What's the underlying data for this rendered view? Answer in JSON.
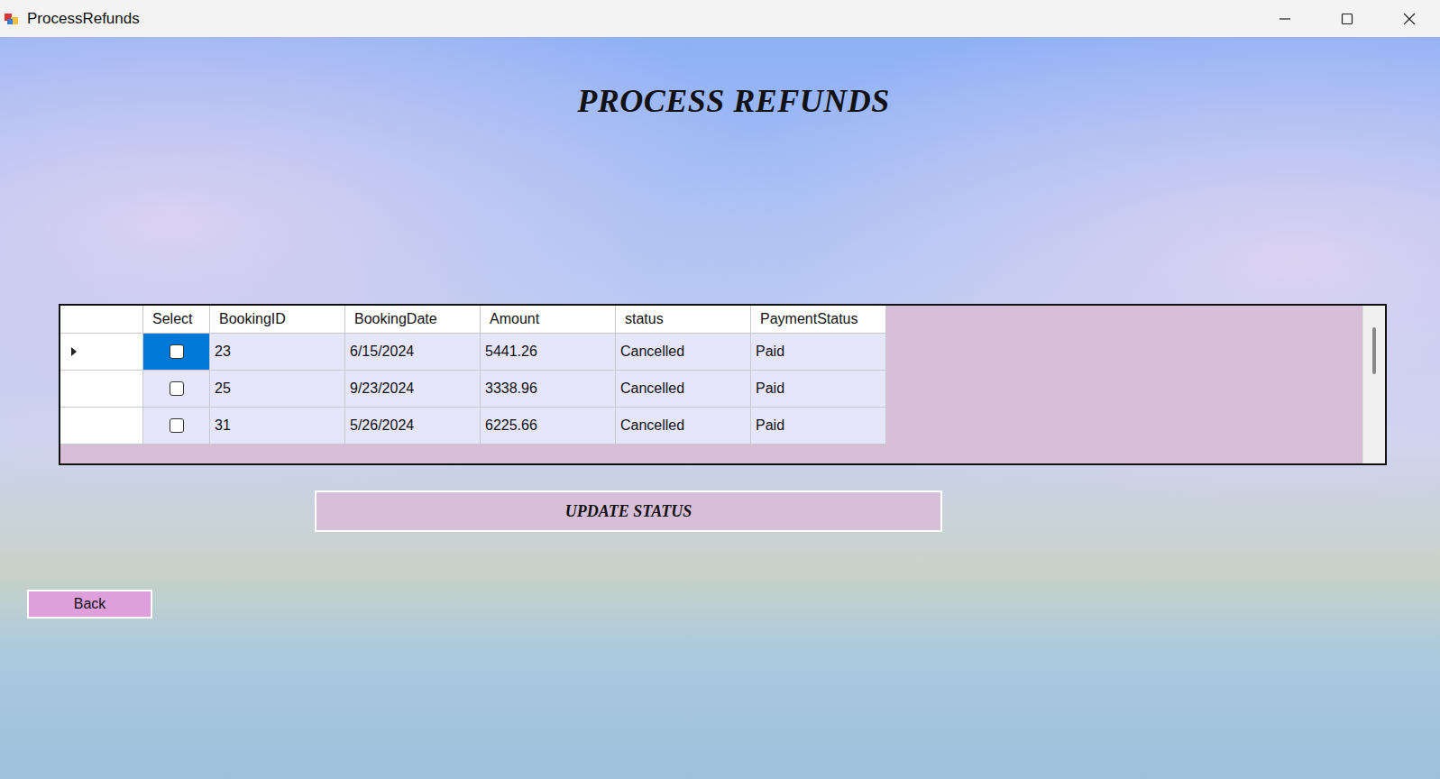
{
  "window": {
    "title": "ProcessRefunds"
  },
  "heading": "PROCESS REFUNDS",
  "table": {
    "columns": [
      "Select",
      "BookingID",
      "BookingDate",
      "Amount",
      "status",
      "PaymentStatus"
    ],
    "rows": [
      {
        "selected": true,
        "checked": false,
        "cells": [
          "23",
          "6/15/2024",
          "5441.26",
          "Cancelled",
          "Paid"
        ]
      },
      {
        "selected": false,
        "checked": false,
        "cells": [
          "25",
          "9/23/2024",
          "3338.96",
          "Cancelled",
          "Paid"
        ]
      },
      {
        "selected": false,
        "checked": false,
        "cells": [
          "31",
          "5/26/2024",
          "6225.66",
          "Cancelled",
          "Paid"
        ]
      }
    ]
  },
  "buttons": {
    "update": "UPDATE STATUS",
    "back": "Back"
  }
}
